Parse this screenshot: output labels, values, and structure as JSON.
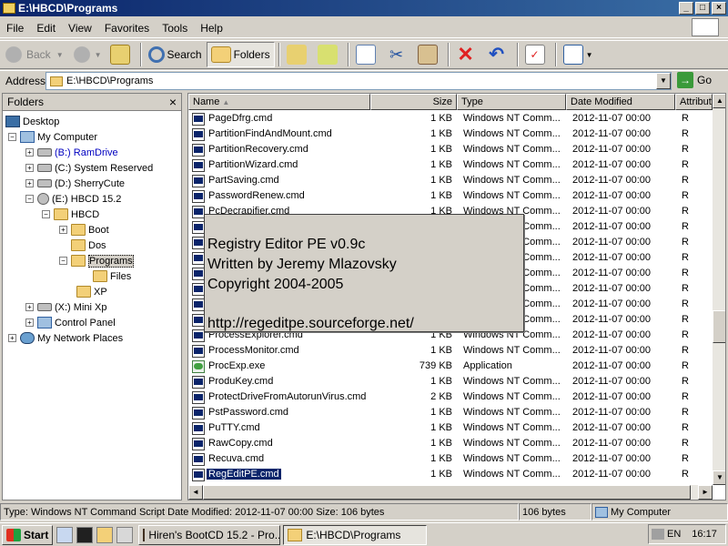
{
  "window": {
    "title": "E:\\HBCD\\Programs"
  },
  "menu": [
    "File",
    "Edit",
    "View",
    "Favorites",
    "Tools",
    "Help"
  ],
  "toolbar": {
    "back": "Back",
    "search": "Search",
    "folders": "Folders"
  },
  "address": {
    "label": "Address",
    "value": "E:\\HBCD\\Programs",
    "go": "Go"
  },
  "folders": {
    "header": "Folders",
    "close": "×",
    "items": [
      {
        "label": "Desktop"
      },
      {
        "label": "My Computer"
      },
      {
        "label": "(B:) RamDrive"
      },
      {
        "label": "(C:) System Reserved"
      },
      {
        "label": "(D:) SherryCute"
      },
      {
        "label": "(E:) HBCD 15.2"
      },
      {
        "label": "HBCD"
      },
      {
        "label": "Boot"
      },
      {
        "label": "Dos"
      },
      {
        "label": "Programs"
      },
      {
        "label": "Files"
      },
      {
        "label": "XP"
      },
      {
        "label": "(X:) Mini Xp"
      },
      {
        "label": "Control Panel"
      },
      {
        "label": "My Network Places"
      }
    ],
    "selected": "Programs",
    "ramdrive_color": "#0000c0"
  },
  "columns": {
    "name": "Name",
    "size": "Size",
    "type": "Type",
    "modified": "Date Modified",
    "attr": "Attribut"
  },
  "files": [
    {
      "name": "PageDfrg.cmd",
      "size": "1 KB",
      "type": "Windows NT Comm...",
      "date": "2012-11-07 00:00",
      "attr": "R"
    },
    {
      "name": "PartitionFindAndMount.cmd",
      "size": "1 KB",
      "type": "Windows NT Comm...",
      "date": "2012-11-07 00:00",
      "attr": "R"
    },
    {
      "name": "PartitionRecovery.cmd",
      "size": "1 KB",
      "type": "Windows NT Comm...",
      "date": "2012-11-07 00:00",
      "attr": "R"
    },
    {
      "name": "PartitionWizard.cmd",
      "size": "1 KB",
      "type": "Windows NT Comm...",
      "date": "2012-11-07 00:00",
      "attr": "R"
    },
    {
      "name": "PartSaving.cmd",
      "size": "1 KB",
      "type": "Windows NT Comm...",
      "date": "2012-11-07 00:00",
      "attr": "R"
    },
    {
      "name": "PasswordRenew.cmd",
      "size": "1 KB",
      "type": "Windows NT Comm...",
      "date": "2012-11-07 00:00",
      "attr": "R"
    },
    {
      "name": "PcDecrapifier.cmd",
      "size": "1 KB",
      "type": "Windows NT Comm...",
      "date": "2012-11-07 00:00",
      "attr": "R"
    },
    {
      "name": "",
      "size": "",
      "type": "Windows NT Comm...",
      "date": "2012-11-07 00:00",
      "attr": "R"
    },
    {
      "name": "",
      "size": "",
      "type": "Windows NT Comm...",
      "date": "2012-11-07 00:00",
      "attr": "R"
    },
    {
      "name": "",
      "size": "",
      "type": "Windows NT Comm...",
      "date": "2012-11-07 00:00",
      "attr": "R"
    },
    {
      "name": "",
      "size": "",
      "type": "Windows NT Comm...",
      "date": "2012-11-07 00:00",
      "attr": "R"
    },
    {
      "name": "",
      "size": "",
      "type": "Windows NT Comm...",
      "date": "2012-11-07 00:00",
      "attr": "R"
    },
    {
      "name": "",
      "size": "",
      "type": "Windows NT Comm...",
      "date": "2012-11-07 00:00",
      "attr": "R"
    },
    {
      "name": "",
      "size": "",
      "type": "Windows NT Comm...",
      "date": "2012-11-07 00:00",
      "attr": "R"
    },
    {
      "name": "ProcessExplorer.cmd",
      "size": "1 KB",
      "type": "Windows NT Comm...",
      "date": "2012-11-07 00:00",
      "attr": "R"
    },
    {
      "name": "ProcessMonitor.cmd",
      "size": "1 KB",
      "type": "Windows NT Comm...",
      "date": "2012-11-07 00:00",
      "attr": "R"
    },
    {
      "name": "ProcExp.exe",
      "size": "739 KB",
      "type": "Application",
      "date": "2012-11-07 00:00",
      "attr": "R"
    },
    {
      "name": "ProduKey.cmd",
      "size": "1 KB",
      "type": "Windows NT Comm...",
      "date": "2012-11-07 00:00",
      "attr": "R"
    },
    {
      "name": "ProtectDriveFromAutorunVirus.cmd",
      "size": "2 KB",
      "type": "Windows NT Comm...",
      "date": "2012-11-07 00:00",
      "attr": "R"
    },
    {
      "name": "PstPassword.cmd",
      "size": "1 KB",
      "type": "Windows NT Comm...",
      "date": "2012-11-07 00:00",
      "attr": "R"
    },
    {
      "name": "PuTTY.cmd",
      "size": "1 KB",
      "type": "Windows NT Comm...",
      "date": "2012-11-07 00:00",
      "attr": "R"
    },
    {
      "name": "RawCopy.cmd",
      "size": "1 KB",
      "type": "Windows NT Comm...",
      "date": "2012-11-07 00:00",
      "attr": "R"
    },
    {
      "name": "Recuva.cmd",
      "size": "1 KB",
      "type": "Windows NT Comm...",
      "date": "2012-11-07 00:00",
      "attr": "R"
    },
    {
      "name": "RegEditPE.cmd",
      "size": "1 KB",
      "type": "Windows NT Comm...",
      "date": "2012-11-07 00:00",
      "attr": "R"
    }
  ],
  "splash": {
    "line1": "Registry Editor PE v0.9c",
    "line2": "Written by Jeremy Mlazovsky",
    "line3": "Copyright 2004-2005",
    "line4": "http://regeditpe.sourceforge.net/"
  },
  "status": {
    "info": "Type: Windows NT Command Script Date Modified: 2012-11-07 00:00 Size: 106 bytes",
    "size": "106 bytes",
    "zone": "My Computer"
  },
  "taskbar": {
    "start": "Start",
    "tasks": [
      "Hiren's BootCD 15.2 - Pro...",
      "E:\\HBCD\\Programs"
    ],
    "lang": "EN",
    "clock": "16:17"
  },
  "icons": [
    "back-icon",
    "forward-icon",
    "up-icon",
    "search-icon",
    "folders-icon",
    "move-to-icon",
    "copy-to-icon",
    "copy-icon",
    "cut-icon",
    "paste-icon",
    "delete-icon",
    "undo-icon",
    "properties-icon",
    "views-icon"
  ],
  "colors": {
    "titlebar": "#0a246a",
    "selection": "#0a246a",
    "face": "#d4d0c8"
  }
}
